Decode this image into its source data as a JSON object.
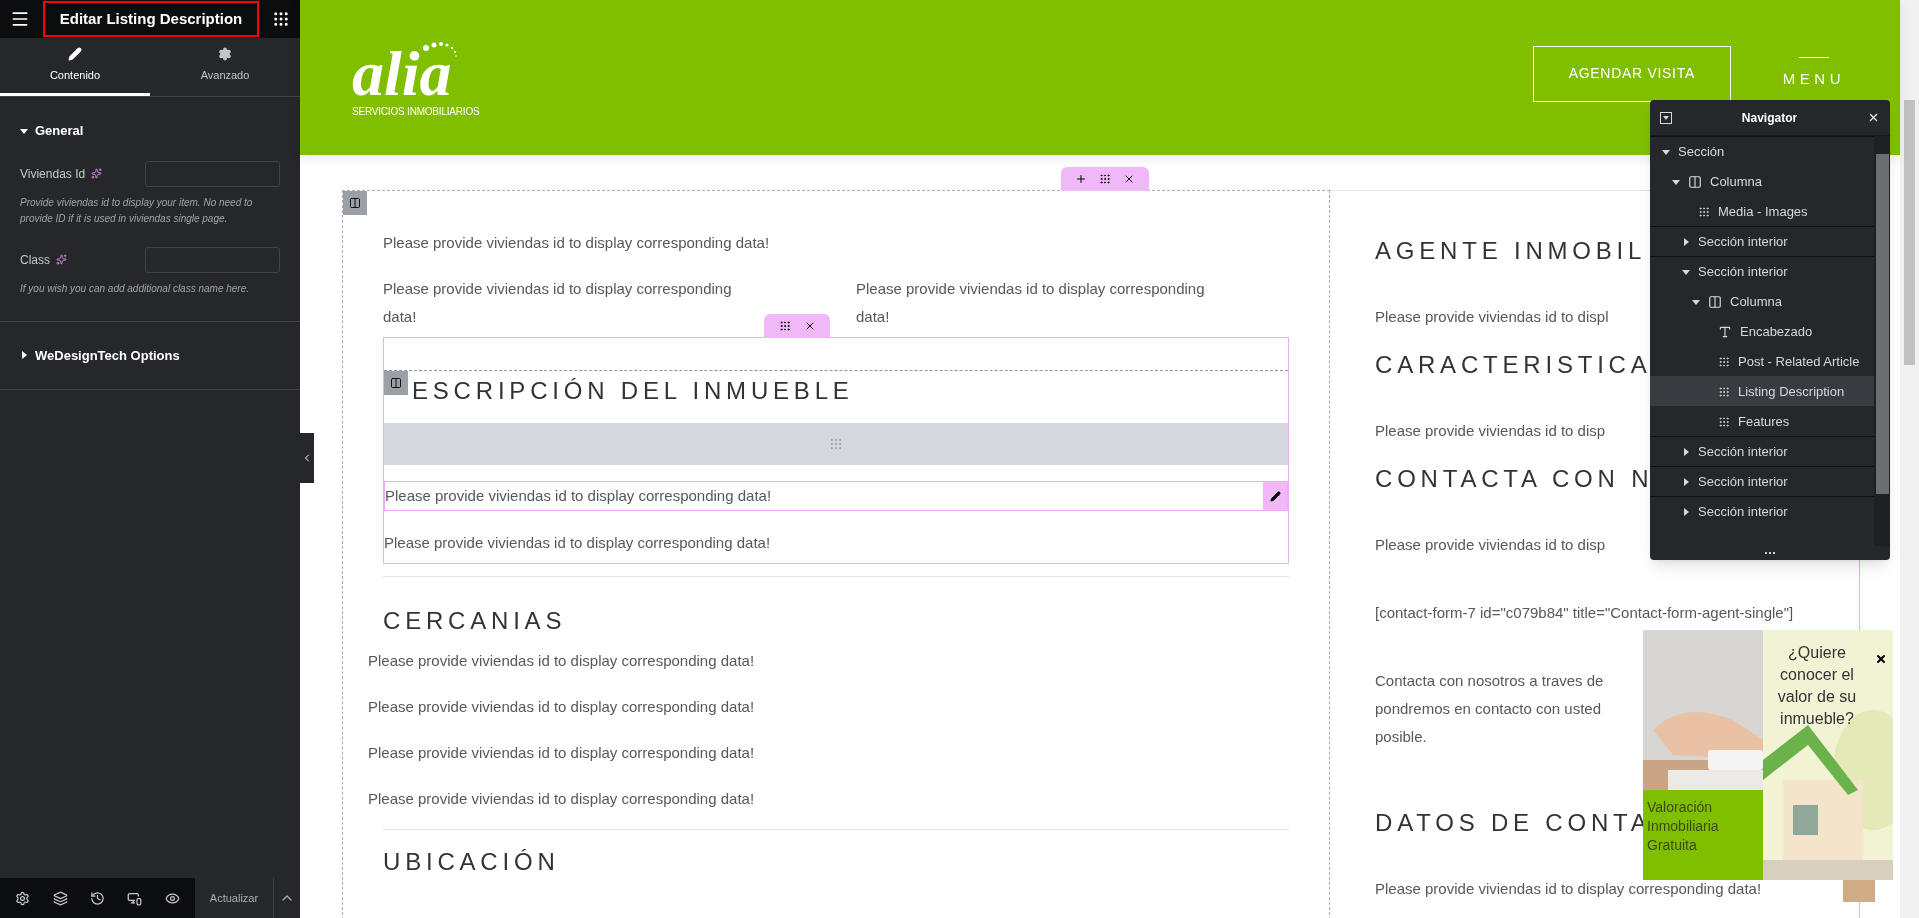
{
  "editor": {
    "title": "Editar Listing Description",
    "tabs": [
      {
        "label": "Contenido",
        "kind": "edit",
        "selected": true
      },
      {
        "label": "Avanzado",
        "kind": "settings",
        "selected": false
      }
    ],
    "sections": [
      {
        "title": "General",
        "expanded": true,
        "fields": [
          {
            "label": "Viviendas Id",
            "help": "Provide viviendas id to display your item. No need to provide ID if it is used in viviendas single page."
          },
          {
            "label": "Class",
            "help": "If you wish you can add additional class name here."
          }
        ]
      },
      {
        "title": "WeDesignTech Options",
        "expanded": false
      }
    ],
    "update_button": "Actualizar"
  },
  "site": {
    "wordmark": "alia",
    "tagline": "SERVICIOS INMOBILIARIOS",
    "cta": "AGENDAR VISITA",
    "menu": "MENU"
  },
  "main_column": {
    "intro": "Please provide viviendas id to display corresponding data!",
    "pair": [
      "Please provide viviendas id to display corresponding data!",
      "Please provide viviendas id to display corresponding data!"
    ],
    "inner": {
      "heading": "ESCRIPCIÓN DEL INMUEBLE",
      "selected_text": "Please provide viviendas id to display corresponding data!",
      "text": "Please provide viviendas id to display corresponding data!"
    },
    "nearby": {
      "heading": "CERCANIAS",
      "items": [
        "Please provide viviendas id to display corresponding data!",
        "Please provide viviendas id to display corresponding data!",
        "Please provide viviendas id to display corresponding data!",
        "Please provide viviendas id to display corresponding data!"
      ]
    },
    "next_heading": "UBICACIÓN"
  },
  "side_column": [
    {
      "kind": "heading",
      "text": "AGENTE INMOBIL"
    },
    {
      "kind": "text",
      "text": "Please provide viviendas id to displ"
    },
    {
      "kind": "heading",
      "text": "CARACTERISTICA"
    },
    {
      "kind": "text",
      "text": "Please provide viviendas id to disp"
    },
    {
      "kind": "heading",
      "text": "CONTACTA CON N"
    },
    {
      "kind": "text",
      "text": "Please provide viviendas id to disp"
    },
    {
      "kind": "text",
      "text": "[contact-form-7 id=\"c079b84\" title=\"Contact-form-agent-single\"]"
    },
    {
      "kind": "lines",
      "lines": [
        "Contacta con nosotros a traves de",
        "pondremos en contacto con usted",
        "posible."
      ]
    },
    {
      "kind": "heading",
      "text": "DATOS DE CONTA"
    },
    {
      "kind": "text",
      "text": "Please provide viviendas id to display corresponding data!"
    }
  ],
  "navigator": {
    "title": "Navigator",
    "items": [
      {
        "label": "Sección",
        "kind": "section",
        "expanded": true,
        "selected": false,
        "children": [
          {
            "label": "Columna",
            "kind": "column",
            "expanded": true,
            "selected": false,
            "children": [
              {
                "label": "Media - Images",
                "kind": "widget",
                "selected": false
              },
              {
                "label": "Sección interior",
                "kind": "section",
                "expanded": false,
                "selected": false
              },
              {
                "label": "Sección interior",
                "kind": "section",
                "expanded": true,
                "selected": false,
                "children": [
                  {
                    "label": "Columna",
                    "kind": "column",
                    "expanded": true,
                    "selected": false,
                    "children": [
                      {
                        "label": "Encabezado",
                        "kind": "heading",
                        "selected": false
                      },
                      {
                        "label": "Post - Related Article",
                        "kind": "widget",
                        "selected": false
                      },
                      {
                        "label": "Listing Description",
                        "kind": "widget",
                        "selected": true
                      },
                      {
                        "label": "Features",
                        "kind": "widget",
                        "selected": false
                      }
                    ]
                  }
                ]
              },
              {
                "label": "Sección interior",
                "kind": "section",
                "expanded": false,
                "selected": false
              },
              {
                "label": "Sección interior",
                "kind": "section",
                "expanded": false,
                "selected": false
              },
              {
                "label": "Sección interior",
                "kind": "section",
                "expanded": false,
                "selected": false
              }
            ]
          }
        ]
      }
    ]
  },
  "promo": {
    "question": "¿Quiere conocer el valor de su inmueble?",
    "banner": "Valoración Inmobiliaria Gratuita"
  }
}
